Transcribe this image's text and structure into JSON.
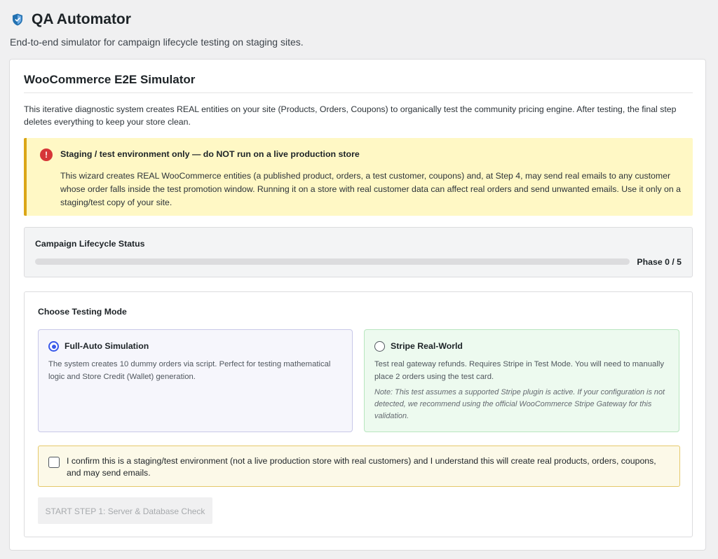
{
  "header": {
    "icon": "shield-icon",
    "title": "QA Automator",
    "subtitle": "End-to-end simulator for campaign lifecycle testing on staging sites."
  },
  "card": {
    "title": "WooCommerce E2E Simulator",
    "description": "This iterative diagnostic system creates REAL entities on your site (Products, Orders, Coupons) to organically test the community pricing engine. After testing, the final step deletes everything to keep your store clean."
  },
  "warning": {
    "icon": "error-icon",
    "icon_glyph": "!",
    "title": "Staging / test environment only — do NOT run on a live production store",
    "body": "This wizard creates REAL WooCommerce entities (a published product, orders, a test customer, coupons) and, at Step 4, may send real emails to any customer whose order falls inside the test promotion window. Running it on a store with real customer data can affect real orders and send unwanted emails. Use it only on a staging/test copy of your site."
  },
  "status": {
    "label": "Campaign Lifecycle Status",
    "progress": 0,
    "phase_text": "Phase 0 / 5"
  },
  "modes": {
    "heading": "Choose Testing Mode",
    "full_auto": {
      "title": "Full-Auto Simulation",
      "selected": true,
      "description": "The system creates 10 dummy orders via script. Perfect for testing mathematical logic and Store Credit (Wallet) generation."
    },
    "stripe": {
      "title": "Stripe Real-World",
      "selected": false,
      "description": "Test real gateway refunds. Requires Stripe in Test Mode. You will need to manually place 2 orders using the test card.",
      "note": "Note: This test assumes a supported Stripe plugin is active. If your configuration is not detected, we recommend using the official WooCommerce Stripe Gateway for this validation."
    }
  },
  "confirm": {
    "checked": false,
    "text": "I confirm this is a staging/test environment (not a live production store with real customers) and I understand this will create real products, orders, coupons, and may send emails."
  },
  "start_button": {
    "label": "START STEP 1: Server & Database Check",
    "disabled": true
  },
  "colors": {
    "accent": "#3858e9",
    "warning_bg": "#fff8c5",
    "warning_border": "#dba617",
    "error": "#d63638",
    "stripe_bg": "#edfaef"
  }
}
